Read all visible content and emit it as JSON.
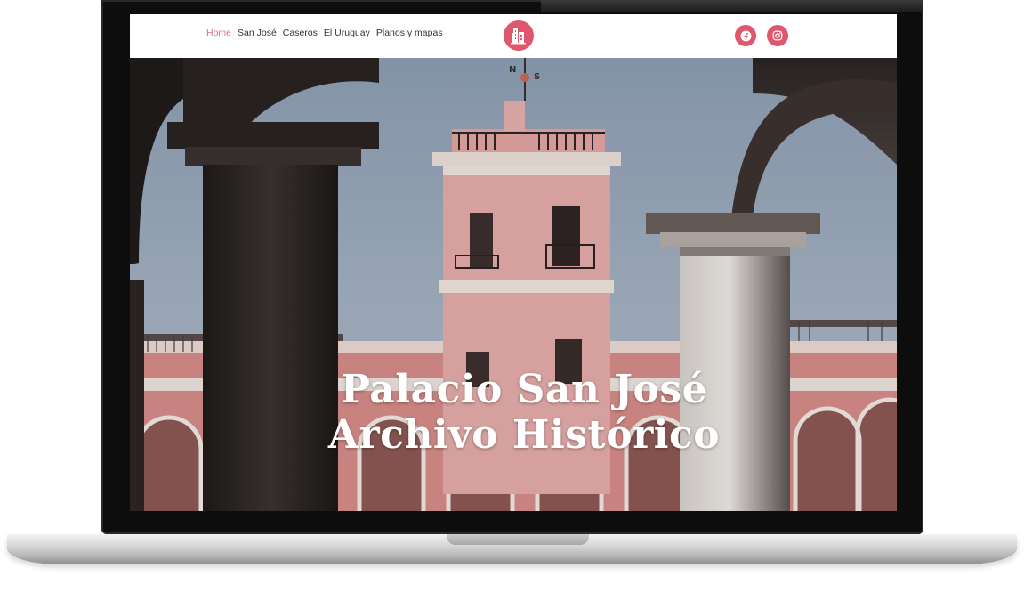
{
  "nav": {
    "items": [
      {
        "label": "Home",
        "active": true
      },
      {
        "label": "San José",
        "active": false
      },
      {
        "label": "Caseros",
        "active": false
      },
      {
        "label": "El Uruguay",
        "active": false
      },
      {
        "label": "Planos y mapas",
        "active": false
      }
    ]
  },
  "logo": {
    "icon": "building-logo-icon"
  },
  "social": [
    {
      "icon": "facebook-icon"
    },
    {
      "icon": "instagram-icon"
    }
  ],
  "hero": {
    "title_line1": "Palacio San José",
    "title_line2": "Archivo Histórico",
    "weathervane_letters": [
      "N",
      "S"
    ]
  },
  "colors": {
    "accent": "#e0566d",
    "nav_active": "#e8687a",
    "nav_text": "#333333",
    "facade_pink": "#e7a9a6",
    "sky": "#9fb0c4"
  }
}
